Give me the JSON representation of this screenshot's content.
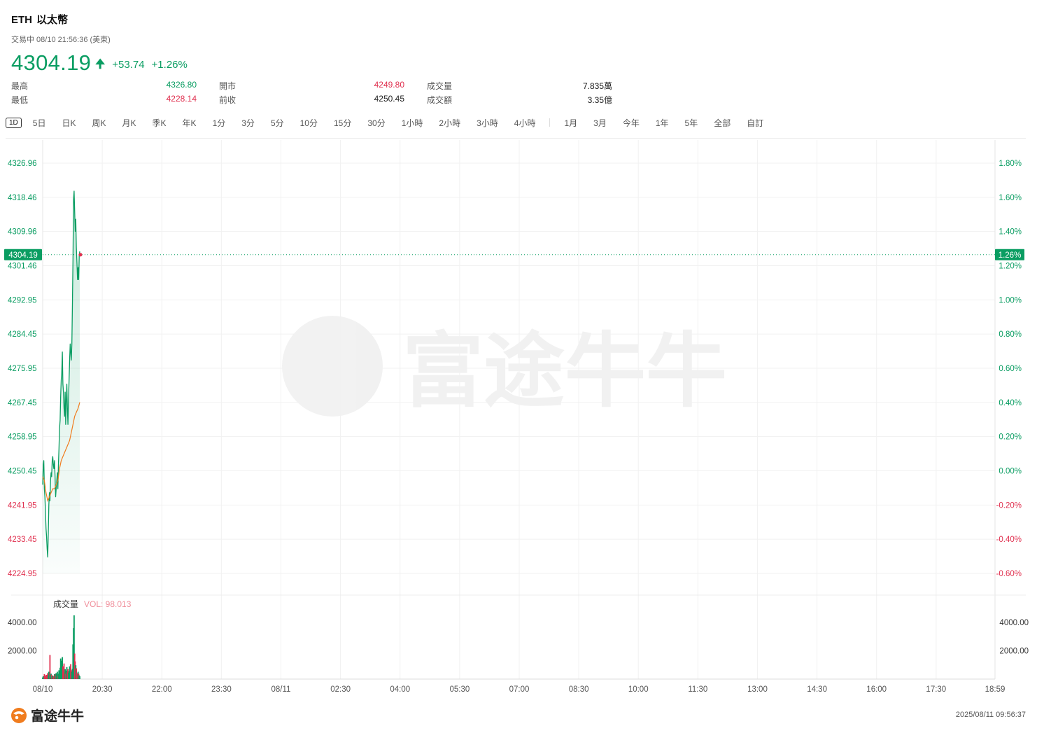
{
  "header": {
    "symbol": "ETH",
    "name": "以太幣",
    "status": "交易中 08/10 21:56:36 (美東)",
    "price": "4304.19",
    "change": "+53.74",
    "change_pct": "+1.26%"
  },
  "stats": {
    "high_label": "最高",
    "high": "4326.80",
    "low_label": "最低",
    "low": "4228.14",
    "open_label": "開市",
    "open": "4249.80",
    "prev_label": "前收",
    "prev": "4250.45",
    "vol_label": "成交量",
    "vol": "7.835萬",
    "amt_label": "成交額",
    "amt": "3.35億"
  },
  "tabs": [
    "1D",
    "5日",
    "日K",
    "周K",
    "月K",
    "季K",
    "年K",
    "1分",
    "3分",
    "5分",
    "10分",
    "15分",
    "30分",
    "1小時",
    "2小時",
    "3小時",
    "4小時",
    "1月",
    "3月",
    "今年",
    "1年",
    "5年",
    "全部",
    "自訂"
  ],
  "footer": {
    "brand": "富途牛牛",
    "timestamp": "2025/08/11 09:56:37"
  },
  "colors": {
    "up": "#0a9d62",
    "down": "#e0304f",
    "avg": "#f07c1e"
  },
  "chart_data": {
    "type": "line",
    "price_axis": {
      "ticks": [
        "4326.96",
        "4318.46",
        "4309.96",
        "4301.46",
        "4292.95",
        "4284.45",
        "4275.95",
        "4267.45",
        "4258.95",
        "4250.45",
        "4241.95",
        "4233.45",
        "4224.95"
      ],
      "pct_ticks": [
        "1.80%",
        "1.60%",
        "1.40%",
        "1.20%",
        "1.00%",
        "0.80%",
        "0.60%",
        "0.40%",
        "0.20%",
        "0.00%",
        "-0.20%",
        "-0.40%",
        "-0.60%"
      ],
      "ylim": [
        4224.95,
        4326.96
      ],
      "current_label": "4304.19",
      "current_pct_label": "1.26%"
    },
    "volume_axis": {
      "title": "成交量",
      "vol_label": "VOL: 98.013",
      "ticks": [
        "4000.00",
        "2000.00"
      ],
      "tick_values": [
        4000,
        2000
      ]
    },
    "x_labels": [
      "08/10",
      "20:30",
      "22:00",
      "23:30",
      "08/11",
      "02:30",
      "04:00",
      "05:30",
      "07:00",
      "08:30",
      "10:00",
      "11:30",
      "13:00",
      "14:30",
      "16:00",
      "17:30",
      "18:59"
    ],
    "session": {
      "start": "08/10 19:00",
      "end": "08/11 18:59",
      "last_point": "21:56"
    },
    "price_series": [
      [
        0,
        4247
      ],
      [
        1,
        4252
      ],
      [
        2,
        4253
      ],
      [
        3,
        4246
      ],
      [
        4,
        4244
      ],
      [
        5,
        4240
      ],
      [
        6,
        4236
      ],
      [
        7,
        4234
      ],
      [
        8,
        4231
      ],
      [
        9,
        4229
      ],
      [
        10,
        4235
      ],
      [
        11,
        4242
      ],
      [
        12,
        4245
      ],
      [
        13,
        4243
      ],
      [
        14,
        4248
      ],
      [
        15,
        4250
      ],
      [
        16,
        4249
      ],
      [
        17,
        4253
      ],
      [
        18,
        4254
      ],
      [
        19,
        4252
      ],
      [
        20,
        4251
      ],
      [
        21,
        4253
      ],
      [
        22,
        4249
      ],
      [
        23,
        4244
      ],
      [
        24,
        4246
      ],
      [
        25,
        4248
      ],
      [
        26,
        4250
      ],
      [
        27,
        4246
      ],
      [
        28,
        4252
      ],
      [
        29,
        4256
      ],
      [
        30,
        4261
      ],
      [
        31,
        4263
      ],
      [
        32,
        4269
      ],
      [
        33,
        4273
      ],
      [
        34,
        4275
      ],
      [
        35,
        4280
      ],
      [
        36,
        4272
      ],
      [
        37,
        4270
      ],
      [
        38,
        4266
      ],
      [
        39,
        4264
      ],
      [
        40,
        4270
      ],
      [
        41,
        4262
      ],
      [
        42,
        4268
      ],
      [
        43,
        4272
      ],
      [
        44,
        4266
      ],
      [
        45,
        4262
      ],
      [
        46,
        4268
      ],
      [
        47,
        4273
      ],
      [
        48,
        4278
      ],
      [
        49,
        4282
      ],
      [
        50,
        4280
      ],
      [
        51,
        4278
      ],
      [
        52,
        4282
      ],
      [
        53,
        4292
      ],
      [
        54,
        4303
      ],
      [
        55,
        4318
      ],
      [
        56,
        4320
      ],
      [
        57,
        4315
      ],
      [
        58,
        4310
      ],
      [
        59,
        4313
      ],
      [
        60,
        4306
      ],
      [
        61,
        4302
      ],
      [
        62,
        4298
      ],
      [
        63,
        4301
      ],
      [
        64,
        4298
      ],
      [
        65,
        4304
      ],
      [
        66,
        4305
      ]
    ],
    "avg_series": [
      [
        0,
        4249
      ],
      [
        3,
        4248
      ],
      [
        6,
        4245
      ],
      [
        9,
        4243
      ],
      [
        12,
        4244
      ],
      [
        15,
        4245
      ],
      [
        18,
        4246
      ],
      [
        21,
        4246
      ],
      [
        24,
        4247
      ],
      [
        27,
        4248
      ],
      [
        30,
        4251
      ],
      [
        33,
        4253
      ],
      [
        36,
        4254
      ],
      [
        39,
        4255
      ],
      [
        42,
        4256
      ],
      [
        45,
        4257
      ],
      [
        48,
        4258
      ],
      [
        51,
        4260
      ],
      [
        54,
        4262
      ],
      [
        57,
        4264
      ],
      [
        60,
        4265
      ],
      [
        63,
        4266
      ],
      [
        66,
        4267.5
      ]
    ],
    "volume_series": [
      [
        0,
        120
      ],
      [
        1,
        200
      ],
      [
        2,
        90
      ],
      [
        3,
        350
      ],
      [
        4,
        180
      ],
      [
        5,
        260
      ],
      [
        6,
        100
      ],
      [
        7,
        300
      ],
      [
        8,
        150
      ],
      [
        9,
        420
      ],
      [
        10,
        210
      ],
      [
        11,
        520
      ],
      [
        12,
        160
      ],
      [
        13,
        1700
      ],
      [
        14,
        280
      ],
      [
        15,
        380
      ],
      [
        16,
        300
      ],
      [
        17,
        190
      ],
      [
        18,
        240
      ],
      [
        19,
        160
      ],
      [
        20,
        210
      ],
      [
        21,
        350
      ],
      [
        22,
        260
      ],
      [
        23,
        380
      ],
      [
        24,
        420
      ],
      [
        25,
        260
      ],
      [
        26,
        520
      ],
      [
        27,
        230
      ],
      [
        28,
        380
      ],
      [
        29,
        620
      ],
      [
        30,
        480
      ],
      [
        31,
        800
      ],
      [
        32,
        1450
      ],
      [
        33,
        700
      ],
      [
        34,
        1300
      ],
      [
        35,
        1550
      ],
      [
        36,
        900
      ],
      [
        37,
        650
      ],
      [
        38,
        1100
      ],
      [
        39,
        500
      ],
      [
        40,
        700
      ],
      [
        41,
        380
      ],
      [
        42,
        600
      ],
      [
        43,
        850
      ],
      [
        44,
        520
      ],
      [
        45,
        700
      ],
      [
        46,
        430
      ],
      [
        47,
        560
      ],
      [
        48,
        900
      ],
      [
        49,
        760
      ],
      [
        50,
        1050
      ],
      [
        51,
        620
      ],
      [
        52,
        500
      ],
      [
        53,
        720
      ],
      [
        54,
        2450
      ],
      [
        55,
        3600
      ],
      [
        56,
        4500
      ],
      [
        57,
        1800
      ],
      [
        58,
        1250
      ],
      [
        59,
        980
      ],
      [
        60,
        760
      ],
      [
        61,
        420
      ],
      [
        62,
        300
      ],
      [
        63,
        520
      ],
      [
        64,
        380
      ],
      [
        65,
        260
      ],
      [
        66,
        200
      ]
    ],
    "volume_colors": "mixed up/down",
    "grid": true,
    "watermark": "富途牛牛"
  }
}
